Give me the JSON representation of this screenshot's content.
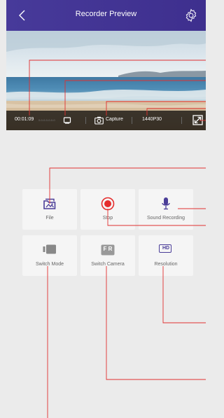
{
  "header": {
    "title": "Recorder Preview",
    "back_icon": "chevron-left-icon",
    "settings_icon": "gear-icon",
    "bg": "#45389a"
  },
  "statusbar": {
    "time": "00:01:09",
    "ghost_text": "0-0-0-0-0-0-0",
    "capture_label": "Capture",
    "resolution": "1440P30"
  },
  "tiles": {
    "file": "File",
    "stop": "Stop",
    "sound_recording": "Sound Recording",
    "switch_mode": "Switch Mode",
    "switch_camera": "Switch Camera",
    "resolution": "Resolution",
    "resolution_badge": "HD",
    "camera_badge": "F R"
  },
  "colors": {
    "accent": "#4a3d98",
    "stop_red": "#e52d2d",
    "callout_red": "#e03030",
    "icon_gray": "#888888"
  }
}
